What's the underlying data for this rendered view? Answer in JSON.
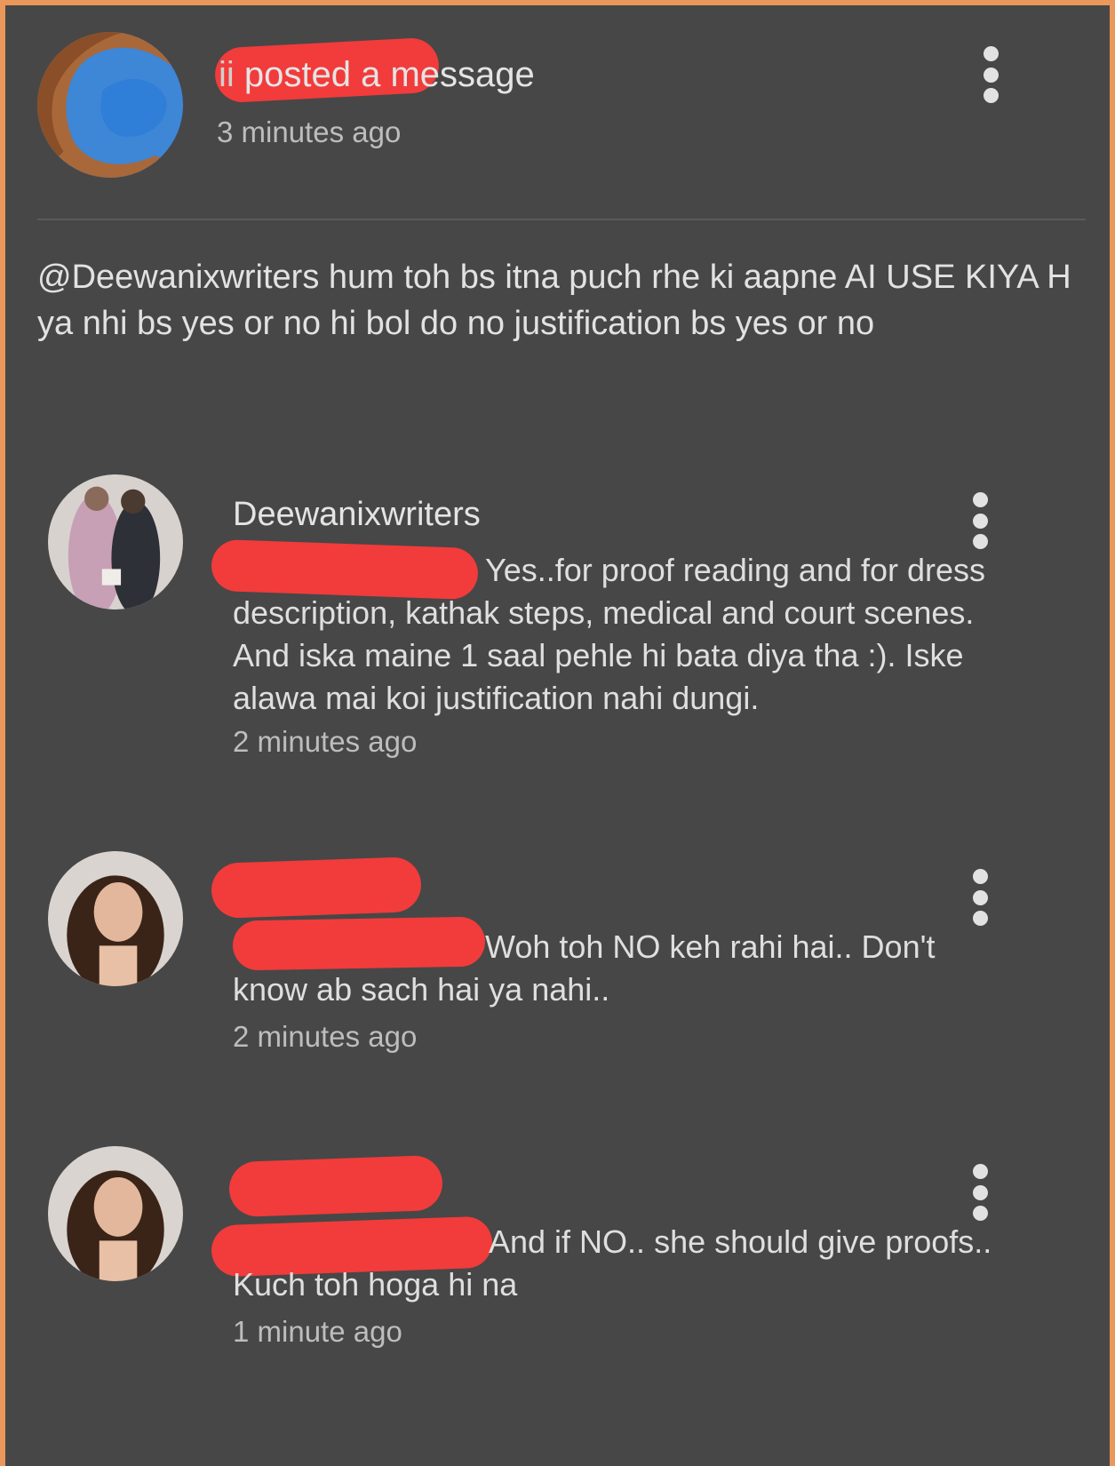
{
  "post": {
    "author_suffix": "ii",
    "action": " posted a message",
    "time": "3 minutes ago",
    "message": "@Deewanixwriters hum toh bs itna puch rhe ki aapne AI USE KIYA H ya nhi bs yes or no hi bol do no justification bs yes or no"
  },
  "comments": [
    {
      "author": "Deewanixwriters",
      "text": "Yes..for proof reading and for dress description, kathak steps, medical and court scenes. And iska maine 1 saal pehle hi bata diya tha :). Iske alawa mai koi justification nahi dungi.",
      "time": "2 minutes ago"
    },
    {
      "author": "",
      "text": "Woh toh NO keh rahi hai.. Don't know ab sach hai ya nahi..",
      "time": "2 minutes ago"
    },
    {
      "author": "",
      "text": "And if NO.. she should give proofs.. Kuch toh hoga hi na",
      "time": "1 minute ago"
    }
  ],
  "icons": {
    "more": "more-vertical-icon",
    "redaction_color": "#f23b3b"
  }
}
